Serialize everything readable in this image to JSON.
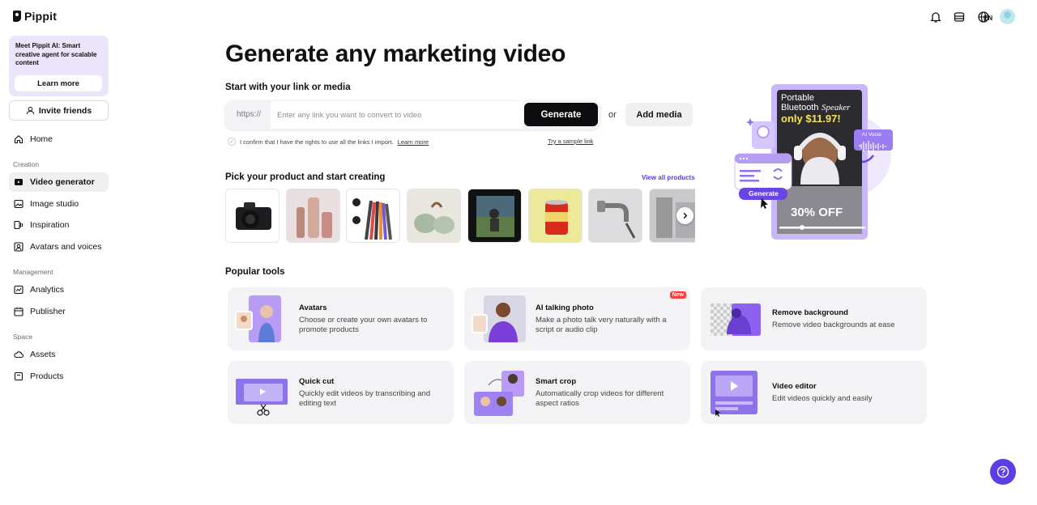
{
  "app": {
    "name": "Pippit"
  },
  "sidebar": {
    "promo": {
      "title": "Meet Pippit AI:",
      "text": "Smart creative agent for scalable content",
      "button": "Learn more"
    },
    "invite": "Invite friends",
    "items": [
      {
        "label": "Home"
      },
      {
        "section": "Creation"
      },
      {
        "label": "Video generator"
      },
      {
        "label": "Image studio"
      },
      {
        "label": "Inspiration"
      },
      {
        "label": "Avatars and voices"
      },
      {
        "section": "Management"
      },
      {
        "label": "Analytics"
      },
      {
        "label": "Publisher"
      },
      {
        "section": "Space"
      },
      {
        "label": "Assets"
      },
      {
        "label": "Products"
      }
    ]
  },
  "header": {
    "lang": "EN"
  },
  "main": {
    "title": "Generate any marketing video",
    "link_section": {
      "heading": "Start with your link or media",
      "prefix": "https://",
      "placeholder": "Enter any link you want to convert to video",
      "generate": "Generate",
      "or": "or",
      "add_media": "Add media",
      "confirm_text": "I confirm that I have the rights to use all the links I import.",
      "confirm_link": "Learn more",
      "sample": "Try a sample link"
    },
    "products": {
      "heading": "Pick your product and start creating",
      "view_all": "View all products"
    },
    "hero": {
      "line1": "Portable",
      "line2": "Bluetooth",
      "line2b": "Speaker",
      "price": "only $11.97!",
      "discount": "30% OFF",
      "ai_voice": "AI Vocie",
      "generate": "Generate"
    },
    "tools": {
      "heading": "Popular tools",
      "items": [
        {
          "title": "Avatars",
          "desc": "Choose or create your own avatars to promote products"
        },
        {
          "title": "AI talking photo",
          "desc": "Make a photo talk very naturally with a script or audio clip",
          "badge": "New"
        },
        {
          "title": "Remove background",
          "desc": "Remove video backgrounds at ease"
        },
        {
          "title": "Quick cut",
          "desc": "Quickly edit videos by transcribing and editing text"
        },
        {
          "title": "Smart crop",
          "desc": "Automatically crop videos for different aspect ratios"
        },
        {
          "title": "Video editor",
          "desc": "Edit videos quickly and easily"
        }
      ]
    }
  },
  "colors": {
    "accent": "#5b3ee6",
    "brand_purple": "#a68bf0",
    "link": "#4f3fe0"
  }
}
